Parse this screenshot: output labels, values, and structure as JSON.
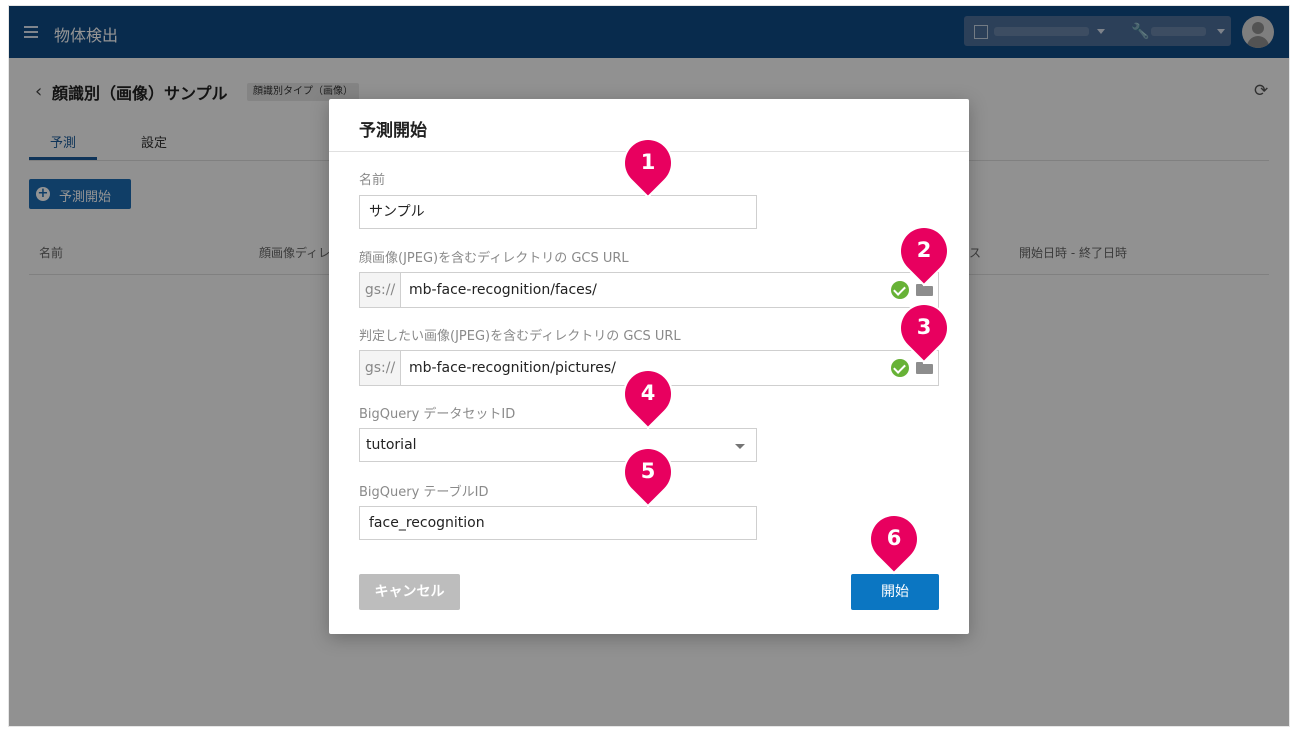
{
  "app": {
    "title": "物体検出",
    "menu_icon": "hamburger-menu-icon",
    "org_icon": "building-icon",
    "project_icon": "wrench-icon",
    "avatar_icon": "user-avatar-icon"
  },
  "page": {
    "back_label": "‹",
    "title": "顔識別（画像）サンプル",
    "badge": "顔識別タイプ（画像）",
    "refresh_icon": "refresh-icon",
    "tabs": [
      {
        "label": "予測"
      },
      {
        "label": "設定"
      }
    ],
    "start_button": "予測開始",
    "columns": [
      {
        "label": "名前"
      },
      {
        "label": "顔画像ディレ"
      },
      {
        "label": "ス"
      },
      {
        "label": "開始日時 - 終了日時"
      }
    ]
  },
  "modal": {
    "title": "予測開始",
    "name_label": "名前",
    "name_value": "サンプル",
    "faces_label": "顔画像(JPEG)を含むディレクトリの GCS URL",
    "faces_prefix": "gs://",
    "faces_value": "mb-face-recognition/faces/",
    "pictures_label": "判定したい画像(JPEG)を含むディレクトリの GCS URL",
    "pictures_prefix": "gs://",
    "pictures_value": "mb-face-recognition/pictures/",
    "dataset_label": "BigQuery データセットID",
    "dataset_value": "tutorial",
    "table_label": "BigQuery テーブルID",
    "table_value": "face_recognition",
    "cancel_label": "キャンセル",
    "start_label": "開始"
  },
  "markers": [
    "1",
    "2",
    "3",
    "4",
    "5",
    "6"
  ],
  "colors": {
    "header": "#0f4a86",
    "primary": "#0b76c2",
    "marker": "#e8005f",
    "valid": "#67b236",
    "cancel": "#bdbdbd"
  }
}
